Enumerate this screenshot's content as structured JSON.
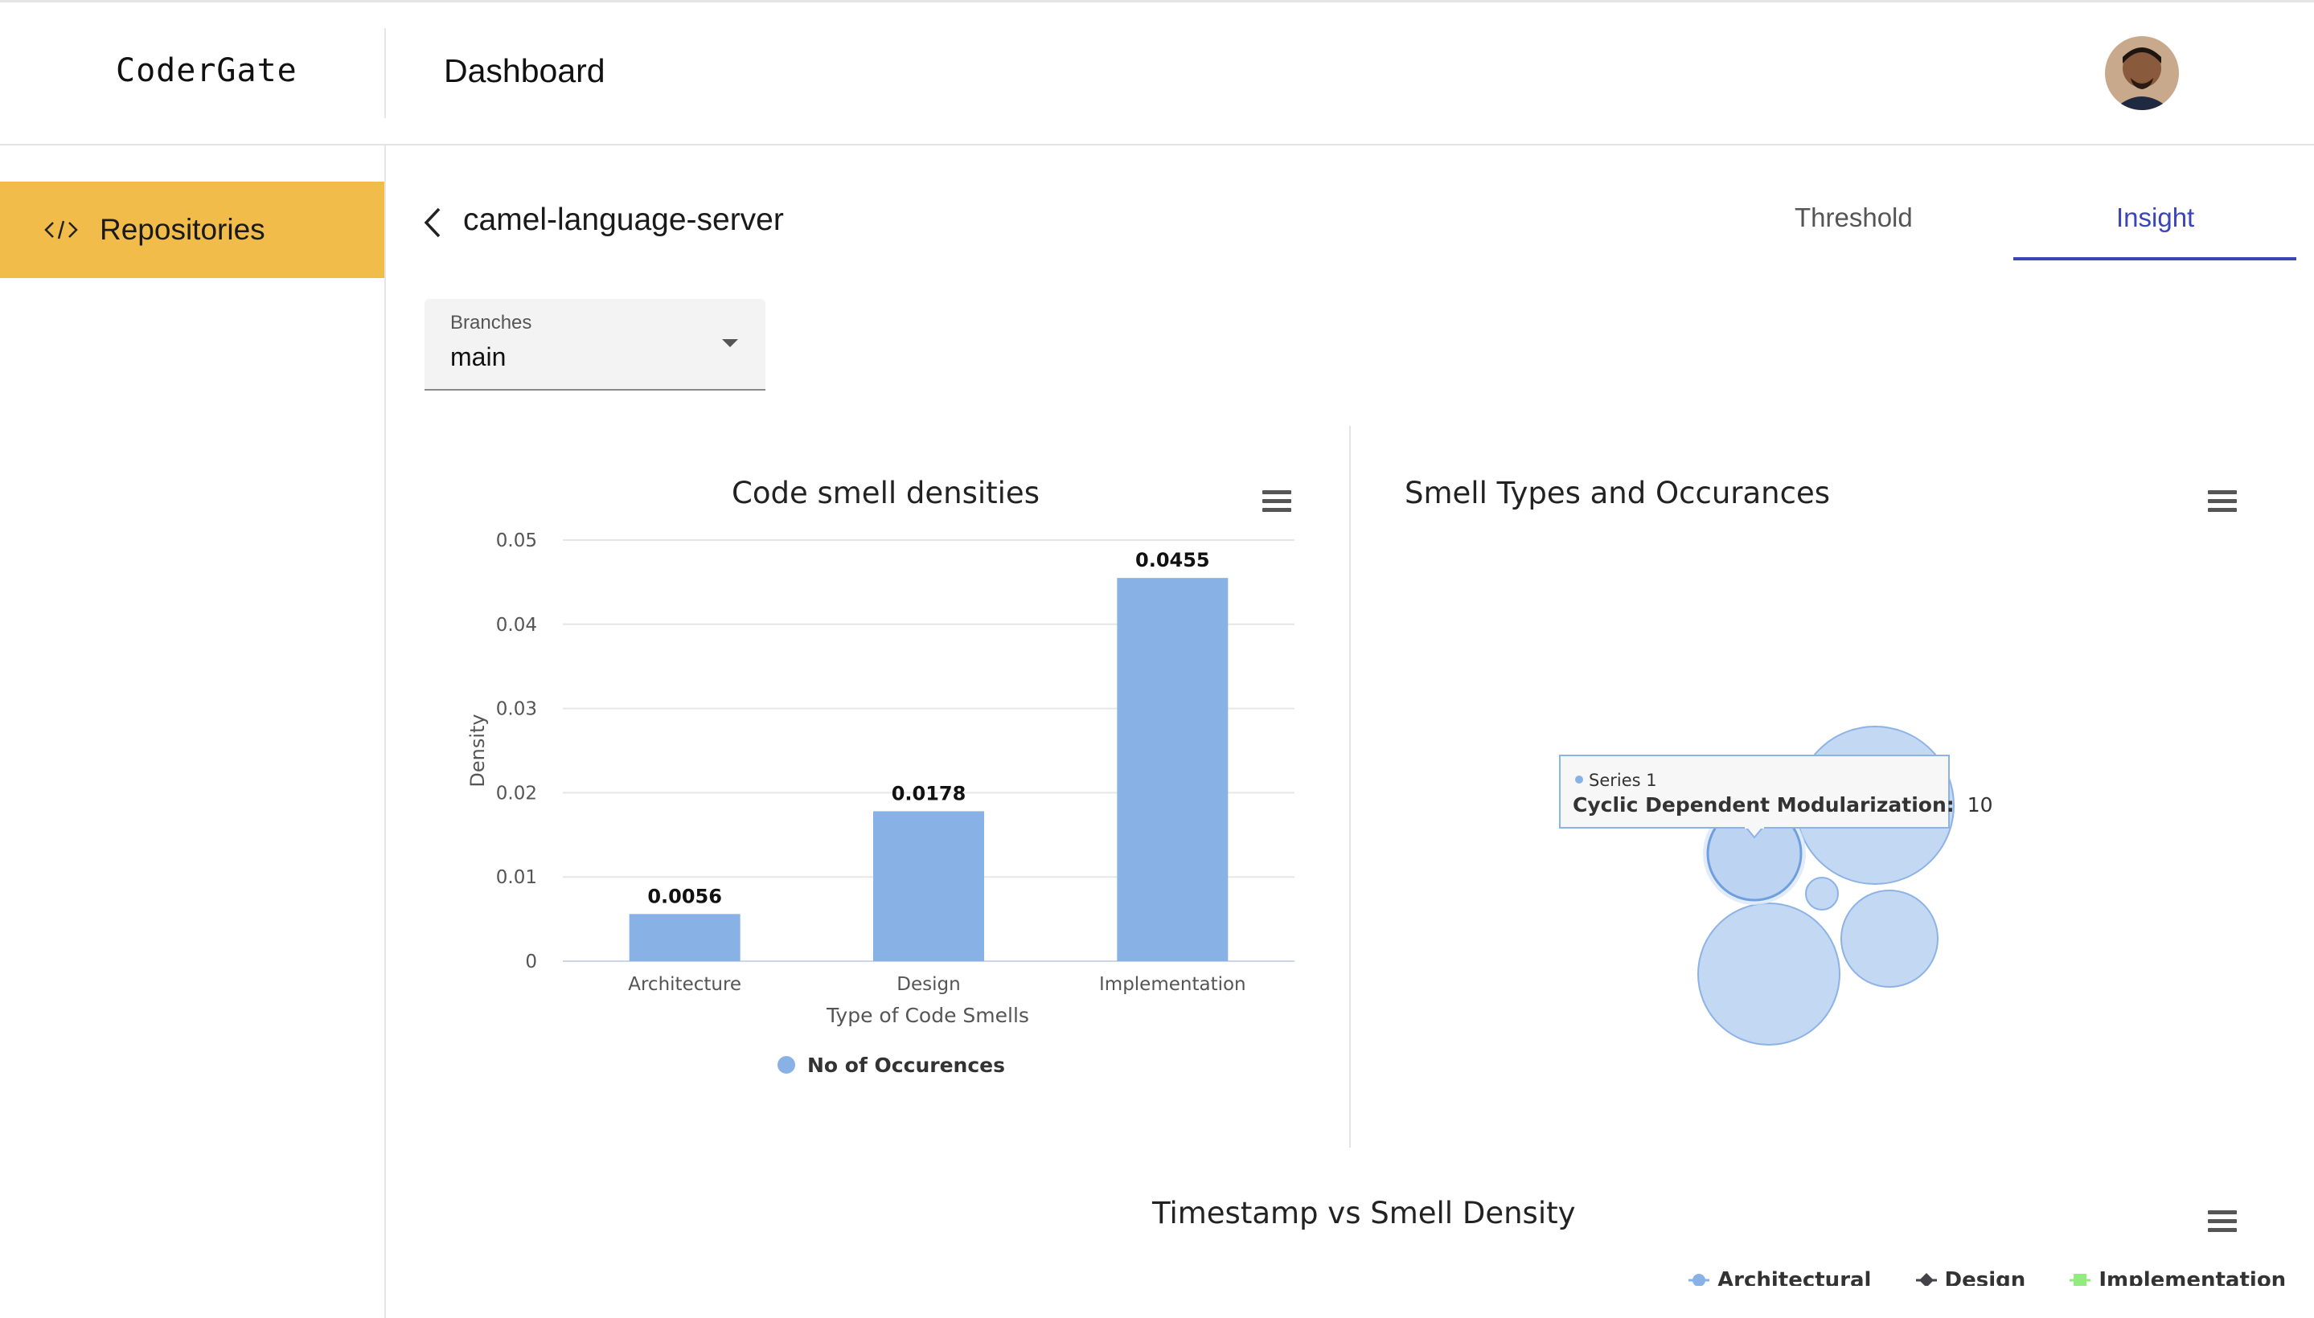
{
  "header": {
    "logo": "CoderGate",
    "title": "Dashboard"
  },
  "sidebar": {
    "items": [
      {
        "label": "Repositories",
        "icon": "code-icon"
      }
    ]
  },
  "repo": {
    "back_icon": "chevron-left-icon",
    "name": "camel-language-server"
  },
  "tabs": [
    {
      "label": "Threshold",
      "active": false
    },
    {
      "label": "Insight",
      "active": true
    }
  ],
  "branch_select": {
    "label": "Branches",
    "value": "main"
  },
  "colors": {
    "accent": "#f1bc4a",
    "tab_active": "#3a46b8",
    "bar": "#88b2e6",
    "bubble": "#c3d8f3",
    "bubble_stroke": "#8db3e6"
  },
  "bubble_tooltip": {
    "series": "Series 1",
    "label": "Cyclic Dependent Modularization:",
    "value": "10"
  },
  "timestamp_chart": {
    "title": "Timestamp vs Smell Density",
    "legend": [
      {
        "name": "Architectural",
        "color": "#88b2e6"
      },
      {
        "name": "Design",
        "color": "#434348"
      },
      {
        "name": "Implementation",
        "color": "#90ed7d"
      }
    ]
  },
  "chart_data": [
    {
      "type": "bar",
      "title": "Code smell densities",
      "categories": [
        "Architecture",
        "Design",
        "Implementation"
      ],
      "values": [
        0.0056,
        0.0178,
        0.0455
      ],
      "data_labels": [
        "0.0056",
        "0.0178",
        "0.0455"
      ],
      "xlabel": "Type of Code Smells",
      "ylabel": "Density",
      "ylim": [
        0,
        0.05
      ],
      "yticks": [
        "0",
        "0.01",
        "0.02",
        "0.03",
        "0.04",
        "0.05"
      ],
      "legend": [
        "No of Occurences"
      ],
      "legend_position": "bottom",
      "grid": true
    },
    {
      "type": "bubble",
      "title": "Smell Types and Occurances",
      "series": [
        {
          "name": "Series 1"
        }
      ],
      "points": [
        {
          "name": "Cyclic Dependent Modularization",
          "value": 10
        }
      ]
    }
  ]
}
